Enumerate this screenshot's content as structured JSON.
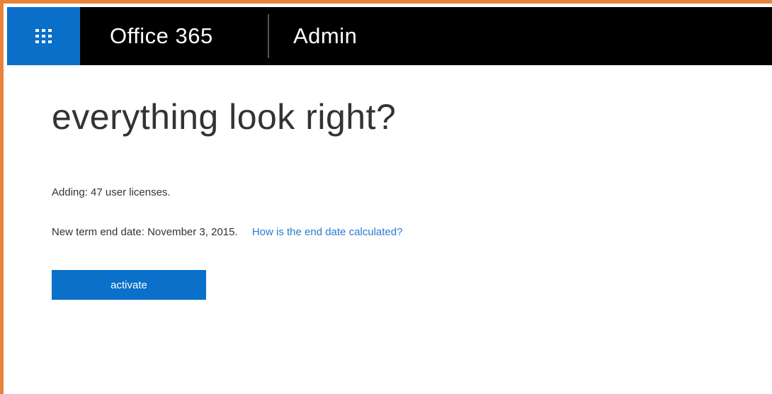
{
  "header": {
    "app_name": "Office 365",
    "section": "Admin",
    "app_launcher_icon": "waffle-grid-icon"
  },
  "main": {
    "title": "everything look right?",
    "adding_text": "Adding: 47 user licenses.",
    "end_date_text": "New term end date: November 3, 2015.",
    "help_link": "How is the end date calculated?",
    "activate_label": "activate"
  },
  "colors": {
    "accent": "#0a70c9",
    "topbar": "#000000",
    "frame": "#e8833a",
    "link": "#2a7bd3"
  }
}
